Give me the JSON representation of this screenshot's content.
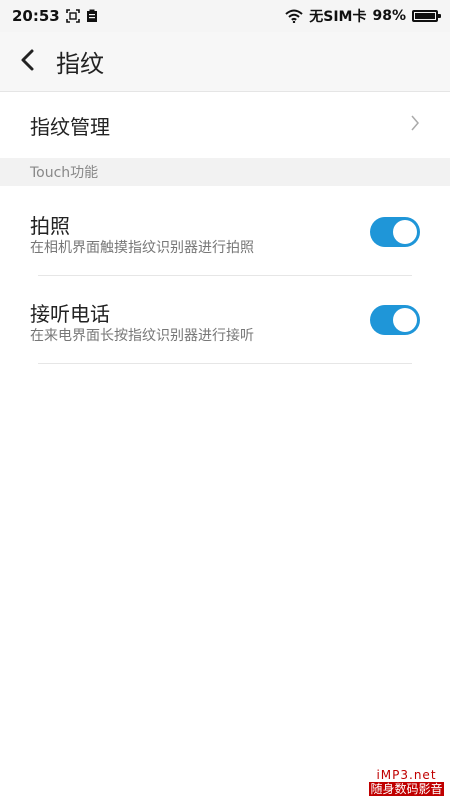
{
  "status_bar": {
    "time": "20:53",
    "carrier": "无SIM卡",
    "battery_percent_text": "98%",
    "battery_level": 0.98,
    "icons": [
      "screenshot-icon",
      "clipboard-icon",
      "wifi-icon",
      "battery-icon"
    ]
  },
  "app_bar": {
    "title": "指纹",
    "back_icon": "chevron-left-icon"
  },
  "manage": {
    "label": "指纹管理",
    "chevron_icon": "chevron-right-icon"
  },
  "section": {
    "header": "Touch功能"
  },
  "settings": [
    {
      "title": "拍照",
      "subtitle": "在相机界面触摸指纹识别器进行拍照",
      "enabled": true
    },
    {
      "title": "接听电话",
      "subtitle": "在来电界面长按指纹识别器进行接听",
      "enabled": true
    }
  ],
  "colors": {
    "accent": "#1f96d8",
    "background": "#ffffff",
    "section_bg": "#f2f2f2"
  },
  "watermark": {
    "line1": "iMP3.net",
    "line2": "随身数码影音"
  }
}
